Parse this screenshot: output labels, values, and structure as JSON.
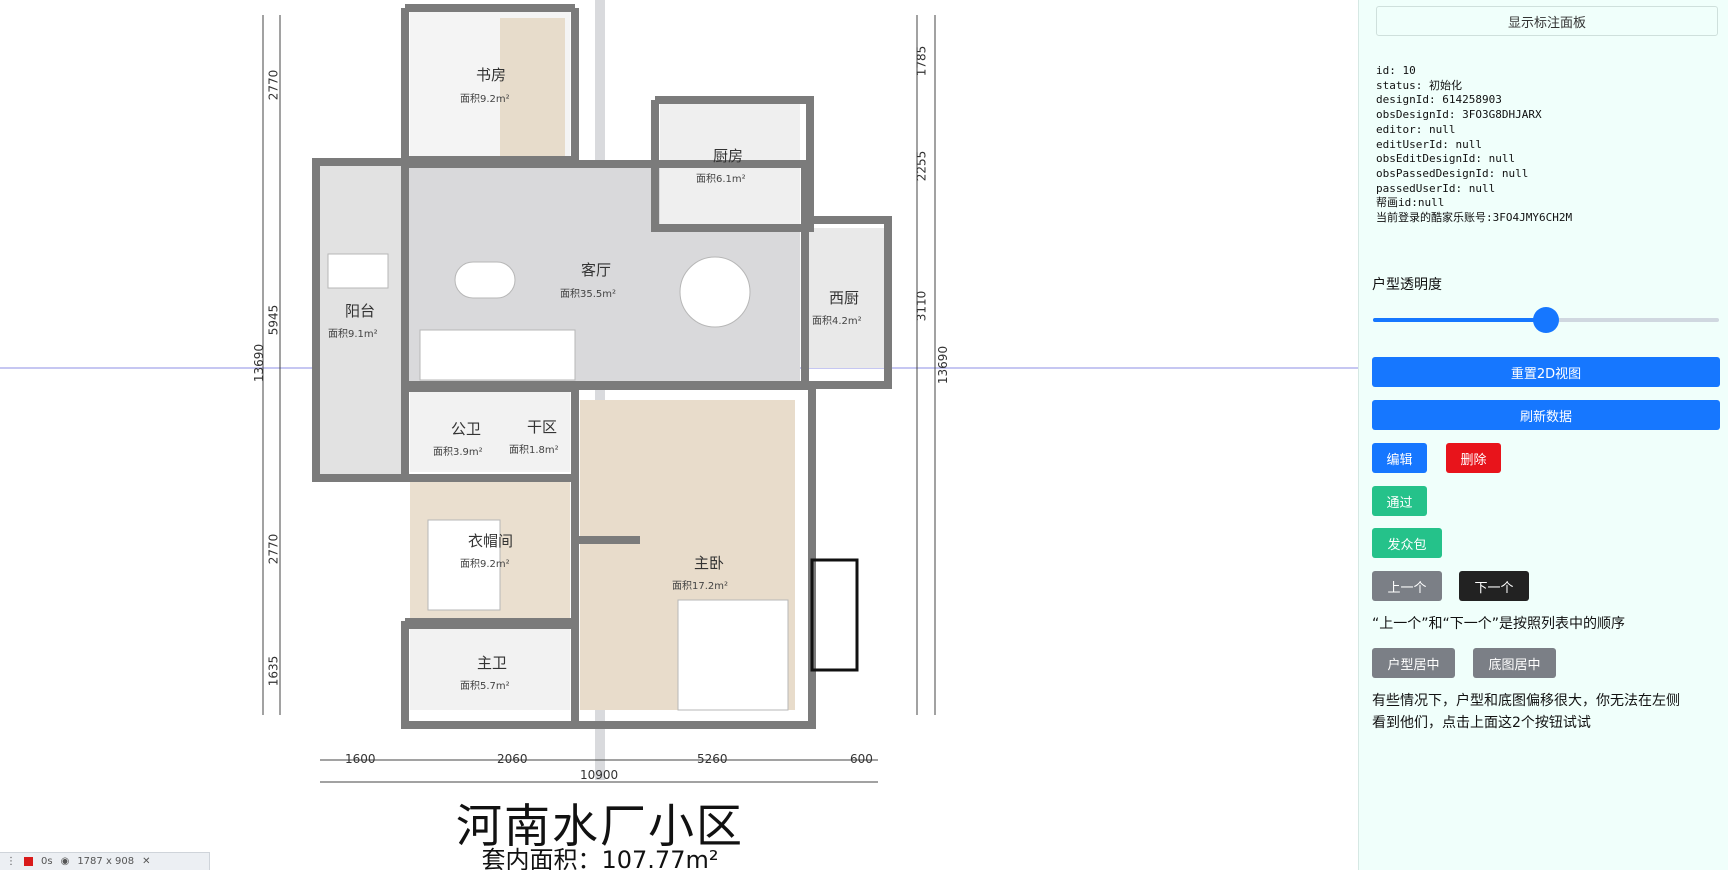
{
  "floorplan": {
    "community_name": "河南水厂小区",
    "interior_area": "套内面积：107.77m²",
    "rooms": [
      {
        "id": "study",
        "name": "书房",
        "area": "面积9.2m²"
      },
      {
        "id": "kitchen",
        "name": "厨房",
        "area": "面积6.1m²"
      },
      {
        "id": "living",
        "name": "客厅",
        "area": "面积35.5m²"
      },
      {
        "id": "balcony",
        "name": "阳台",
        "area": "面积9.1m²"
      },
      {
        "id": "western-kitchen",
        "name": "西厨",
        "area": "面积4.2m²"
      },
      {
        "id": "public-bath",
        "name": "公卫",
        "area": "面积3.9m²"
      },
      {
        "id": "dry-zone",
        "name": "干区",
        "area": "面积1.8m²"
      },
      {
        "id": "closet",
        "name": "衣帽间",
        "area": "面积9.2m²"
      },
      {
        "id": "master-bedroom",
        "name": "主卧",
        "area": "面积17.2m²"
      },
      {
        "id": "master-bath",
        "name": "主卫",
        "area": "面积5.7m²"
      }
    ],
    "dims_left": [
      "2770",
      "5945",
      "2770",
      "1635"
    ],
    "dims_left_total": "13690",
    "dims_right": [
      "1785",
      "2255",
      "3110"
    ],
    "dims_right_total": "13690",
    "dims_bottom": [
      "1600",
      "2060",
      "5260",
      "600"
    ],
    "dims_bottom_total": "10900"
  },
  "panel": {
    "toggle_label": "显示标注面板",
    "info_lines": [
      "id: 10",
      "status: 初始化",
      "designId: 614258903",
      "obsDesignId: 3FO3G8DHJARX",
      "editor: null",
      "editUserId: null",
      "obsEditDesignId: null",
      "obsPassedDesignId: null",
      "passedUserId: null",
      "帮画id:null",
      "当前登录的酷家乐账号:3FO4JMY6CH2M"
    ],
    "opacity_label": "户型透明度",
    "opacity_value": 0.5,
    "reset_label": "重置2D视图",
    "refresh_label": "刷新数据",
    "edit_label": "编辑",
    "delete_label": "删除",
    "pass_label": "通过",
    "crowd_label": "发众包",
    "prev_label": "上一个",
    "next_label": "下一个",
    "order_note": "“上一个”和“下一个”是按照列表中的顺序",
    "center_plan_label": "户型居中",
    "center_base_label": "底图居中",
    "offset_note_1": "有些情况下，户型和底图偏移很大，你无法在左侧",
    "offset_note_2": "看到他们，点击上面这2个按钮试试"
  },
  "colors": {
    "primary": "#1677ff",
    "danger": "#e8141b",
    "success": "#25c28a",
    "gray": "#7b7f86",
    "dark": "#222222",
    "panel_bg": "#f0fffb"
  },
  "devtools": {
    "time": "0s",
    "size": "1787 x 908"
  }
}
